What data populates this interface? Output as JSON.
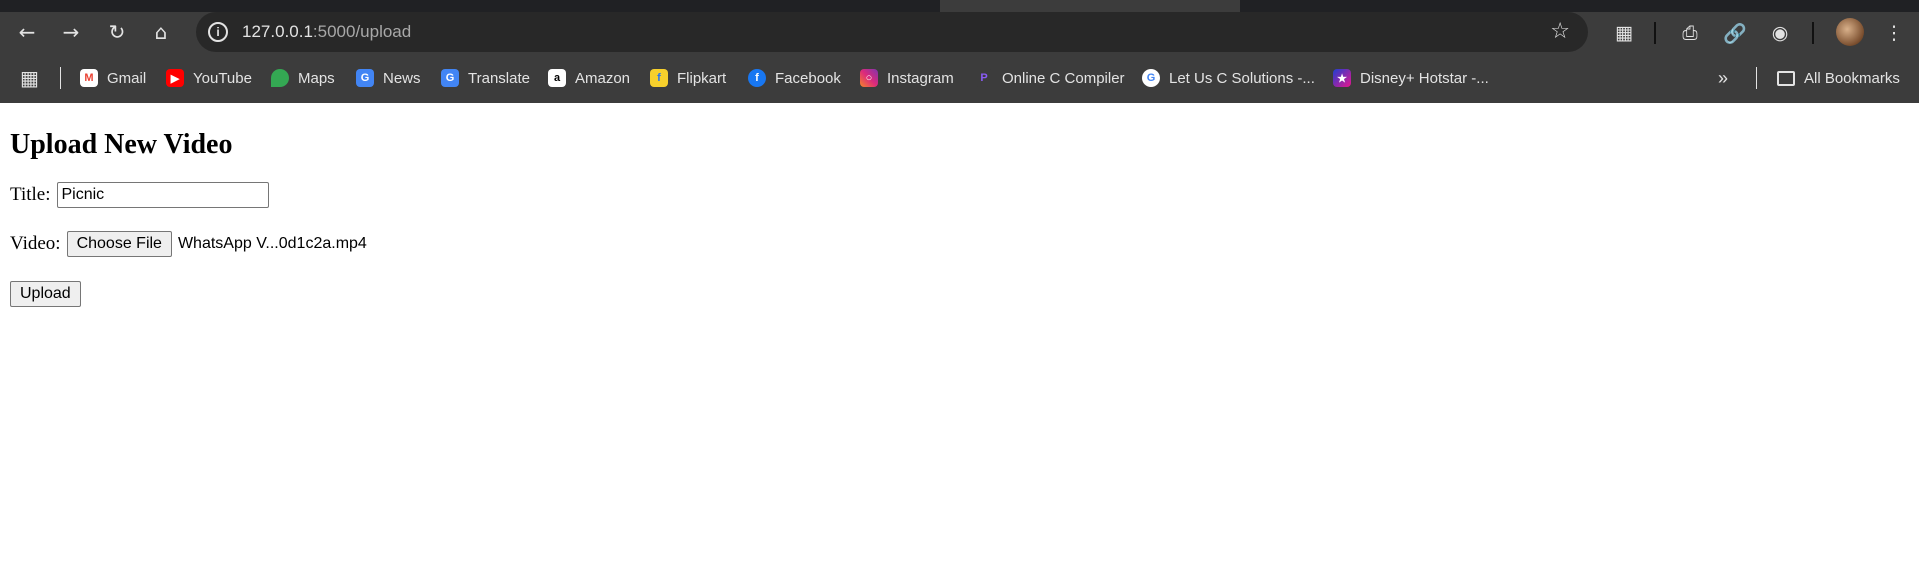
{
  "browser": {
    "url_host": "127.0.0.1",
    "url_rest": ":5000/upload",
    "bookmarks": [
      {
        "label": "Gmail",
        "icon": "gmail-icon",
        "color": "#ea4335"
      },
      {
        "label": "YouTube",
        "icon": "youtube-icon",
        "color": "#ff0000"
      },
      {
        "label": "Maps",
        "icon": "maps-icon",
        "color": "#34a853"
      },
      {
        "label": "News",
        "icon": "news-icon",
        "color": "#4285f4"
      },
      {
        "label": "Translate",
        "icon": "translate-icon",
        "color": "#4285f4"
      },
      {
        "label": "Amazon",
        "icon": "amazon-icon",
        "color": "#ffffff"
      },
      {
        "label": "Flipkart",
        "icon": "flipkart-icon",
        "color": "#f7d02c"
      },
      {
        "label": "Facebook",
        "icon": "facebook-icon",
        "color": "#1877f2"
      },
      {
        "label": "Instagram",
        "icon": "instagram-icon",
        "color": "#e1306c"
      },
      {
        "label": "Online C Compiler",
        "icon": "programiz-icon",
        "color": "#6b3fd6"
      },
      {
        "label": "Let Us C Solutions -...",
        "icon": "google-icon",
        "color": "#ffffff"
      },
      {
        "label": "Disney+ Hotstar -...",
        "icon": "hotstar-icon",
        "color": "#1f3fd1"
      }
    ],
    "all_bookmarks_label": "All Bookmarks"
  },
  "page": {
    "heading": "Upload New Video",
    "title_label": "Title:",
    "title_value": "Picnic",
    "video_label": "Video:",
    "choose_file_label": "Choose File",
    "chosen_file_name": "WhatsApp V...0d1c2a.mp4",
    "upload_label": "Upload"
  }
}
